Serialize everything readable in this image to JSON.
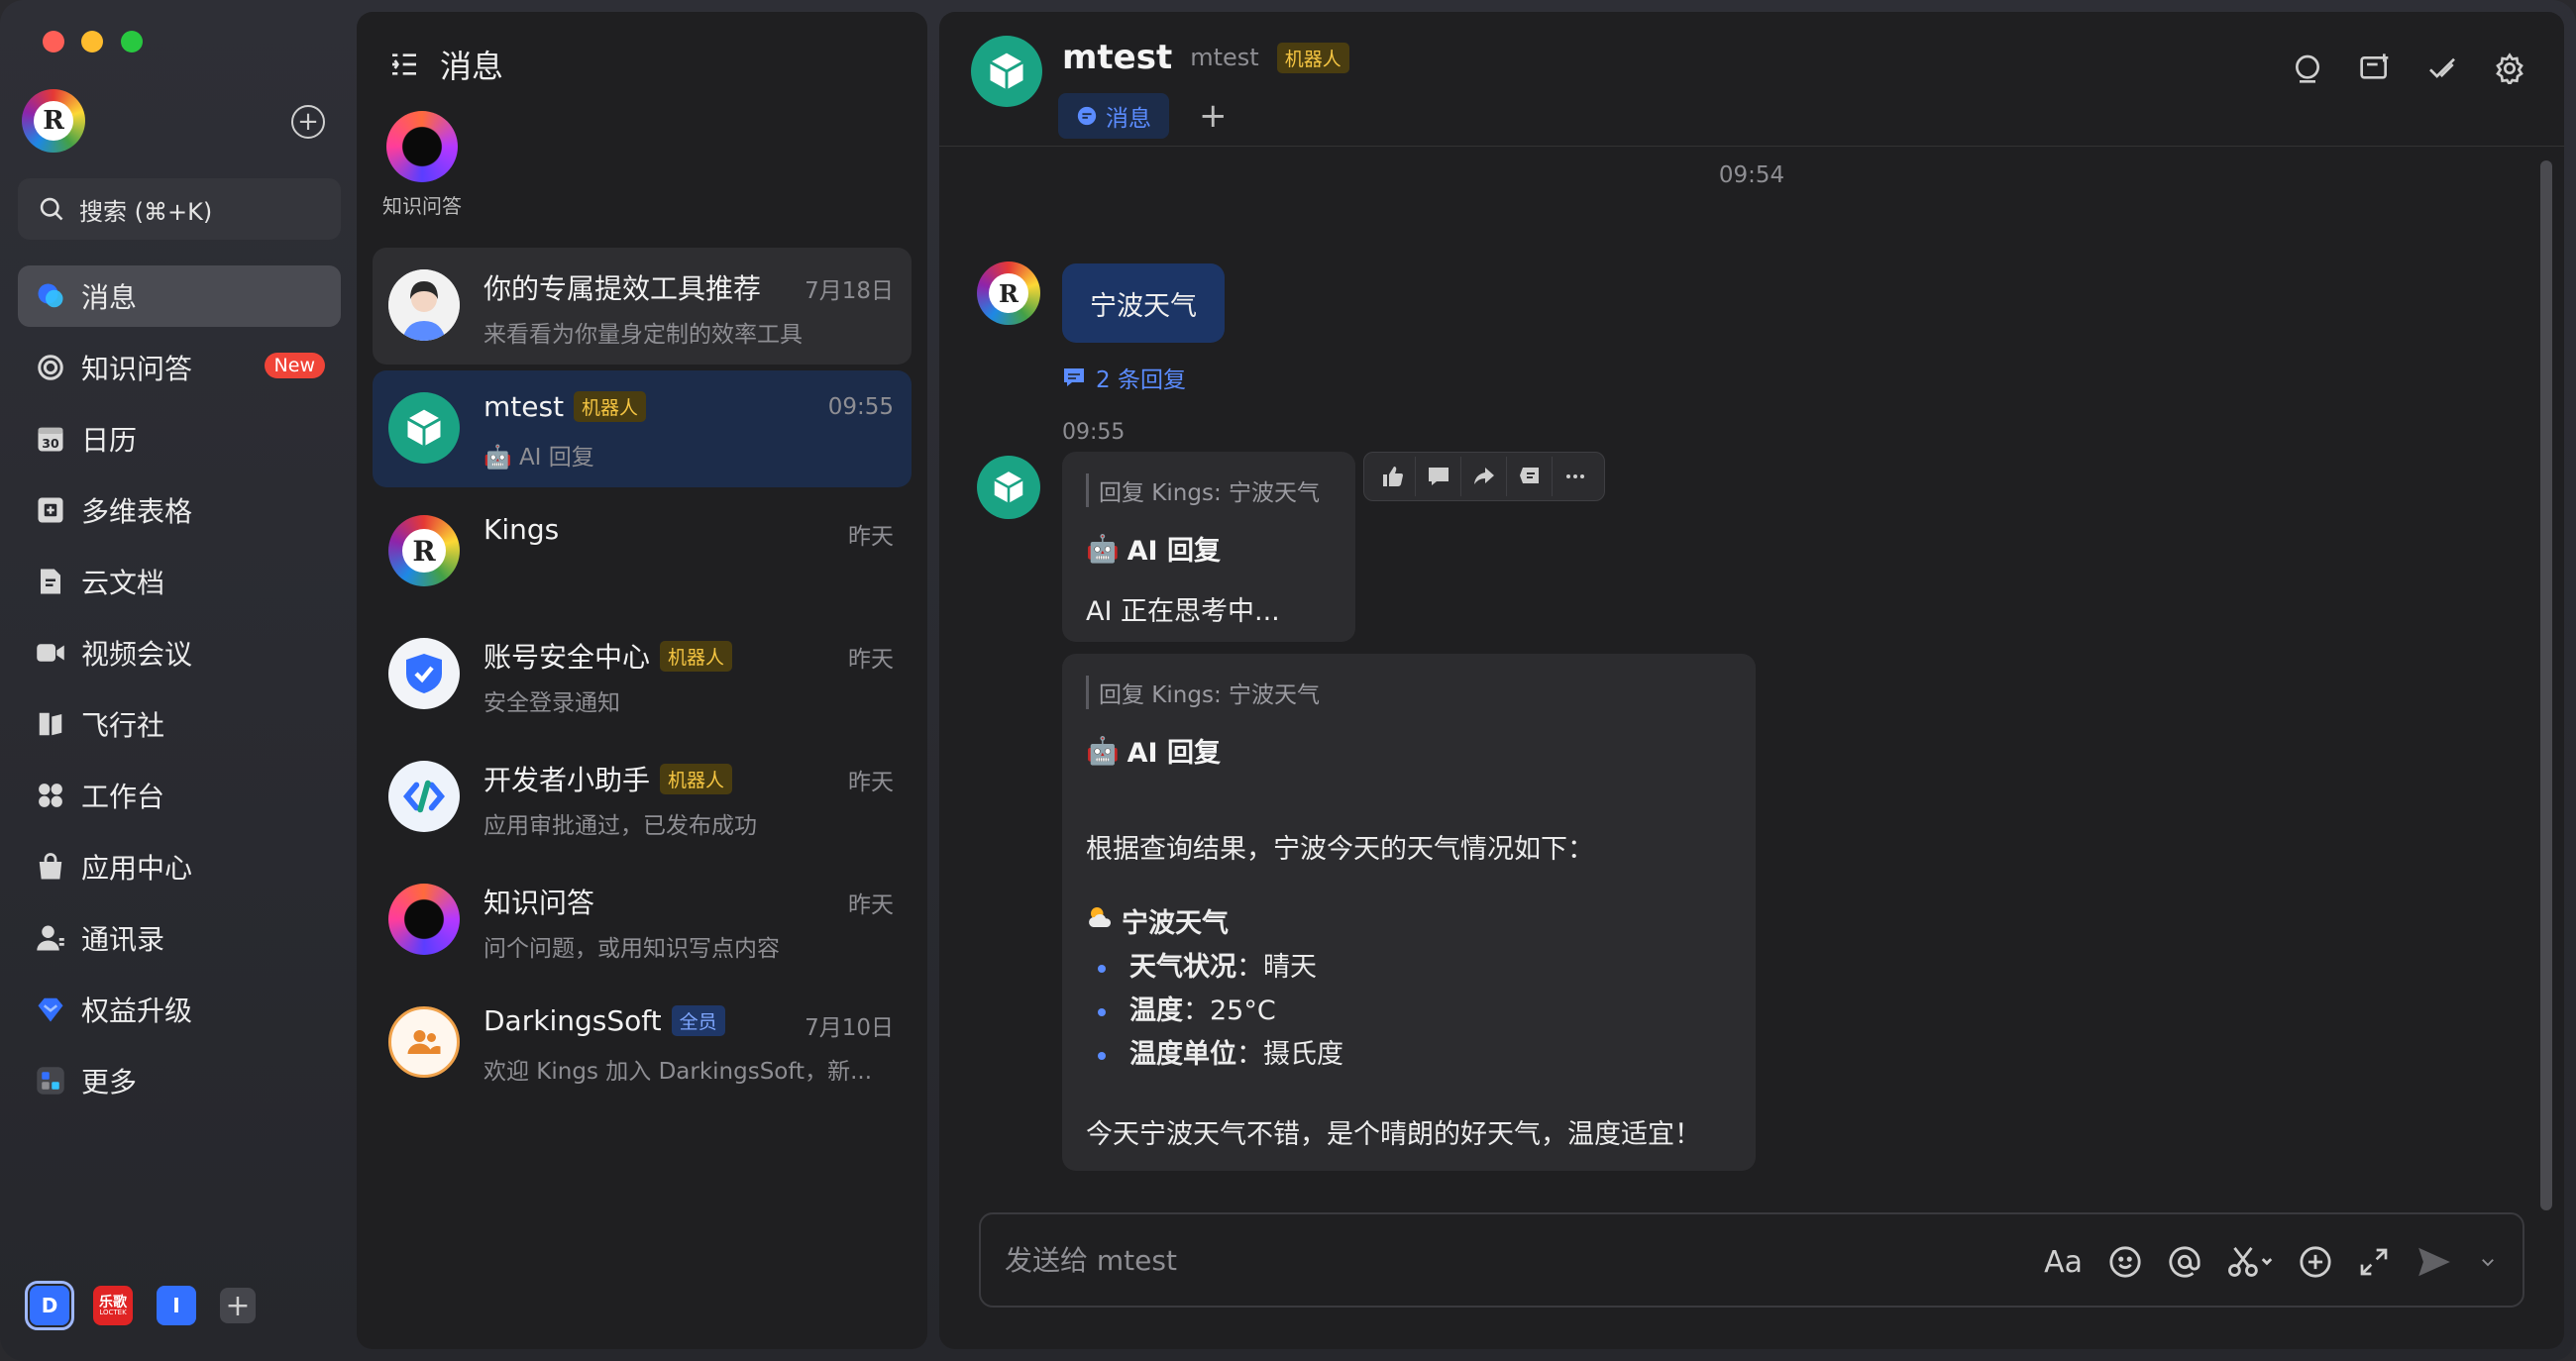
{
  "colors": {
    "accent": "#3370ff",
    "bot_teal": "#1aa384",
    "new_badge": "#f04438",
    "bot_tag": "#f5c542"
  },
  "sidebar": {
    "search_label": "搜索 (⌘+K)",
    "nav": [
      {
        "label": "消息",
        "icon": "chat-bubble-icon"
      },
      {
        "label": "知识问答",
        "icon": "knowledge-ring-icon",
        "badge": "New"
      },
      {
        "label": "日历",
        "icon": "calendar-icon",
        "icon_text": "30"
      },
      {
        "label": "多维表格",
        "icon": "table-grid-icon"
      },
      {
        "label": "云文档",
        "icon": "document-icon"
      },
      {
        "label": "视频会议",
        "icon": "video-camera-icon"
      },
      {
        "label": "飞行社",
        "icon": "book-icon"
      },
      {
        "label": "工作台",
        "icon": "apps-grid-icon"
      },
      {
        "label": "应用中心",
        "icon": "shopping-bag-icon"
      },
      {
        "label": "通讯录",
        "icon": "contacts-icon"
      },
      {
        "label": "权益升级",
        "icon": "diamond-icon"
      },
      {
        "label": "更多",
        "icon": "more-apps-icon"
      }
    ],
    "workspaces": [
      {
        "label": "D"
      },
      {
        "label": "乐歌",
        "sub": "LOCTEK"
      },
      {
        "label": "I"
      }
    ]
  },
  "list": {
    "title": "消息",
    "pinned": {
      "label": "知识问答"
    },
    "items": [
      {
        "name": "你的专属提效工具推荐",
        "sub": "来看看为你量身定制的效率工具",
        "time": "7月18日"
      },
      {
        "name": "mtest",
        "tag": "机器人",
        "sub": "🤖 AI 回复",
        "time": "09:55"
      },
      {
        "name": "Kings",
        "sub": "",
        "time": "昨天"
      },
      {
        "name": "账号安全中心",
        "tag": "机器人",
        "sub": "安全登录通知",
        "time": "昨天"
      },
      {
        "name": "开发者小助手",
        "tag": "机器人",
        "sub": "应用审批通过，已发布成功",
        "time": "昨天"
      },
      {
        "name": "知识问答",
        "sub": "问个问题，或用知识写点内容",
        "time": "昨天"
      },
      {
        "name": "DarkingsSoft",
        "tag_all": "全员",
        "sub": "欢迎 Kings 加入 DarkingsSoft，新...",
        "time": "7月10日"
      }
    ]
  },
  "chat": {
    "name": "mtest",
    "id": "mtest",
    "tag": "机器人",
    "tab_label": "消息",
    "tab_add": "+",
    "time_divider": "09:54",
    "user_message": "宁波天气",
    "reply_count": "2 条回复",
    "bot_time": "09:55",
    "card1": {
      "quote": "回复 Kings: 宁波天气",
      "ai_title": "AI 回复",
      "text": "AI 正在思考中..."
    },
    "card2": {
      "quote": "回复 Kings: 宁波天气",
      "ai_title": "AI 回复",
      "intro": "根据查询结果，宁波今天的天气情况如下：",
      "weather_title": "宁波天气",
      "items": [
        {
          "key": "天气状况",
          "value": "晴天"
        },
        {
          "key": "温度",
          "value": "25°C"
        },
        {
          "key": "温度单位",
          "value": "摄氏度"
        }
      ],
      "summary": "今天宁波天气不错，是个晴朗的好天气，温度适宜！"
    },
    "composer_placeholder": "发送给 mtest",
    "composer_format_label": "Aa"
  }
}
